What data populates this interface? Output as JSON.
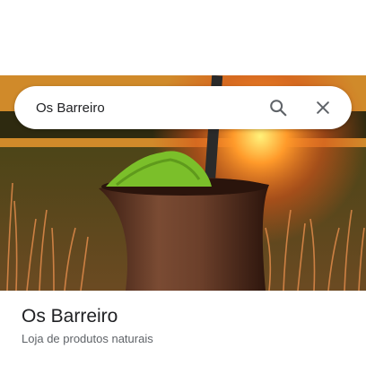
{
  "search": {
    "query": "Os Barreiro",
    "search_icon": "search-icon",
    "close_icon": "close-icon"
  },
  "place": {
    "title": "Os Barreiro",
    "category": "Loja de produtos naturais"
  },
  "colors": {
    "text_primary": "#202124",
    "text_secondary": "#5f6368",
    "icon": "#5f6368"
  }
}
